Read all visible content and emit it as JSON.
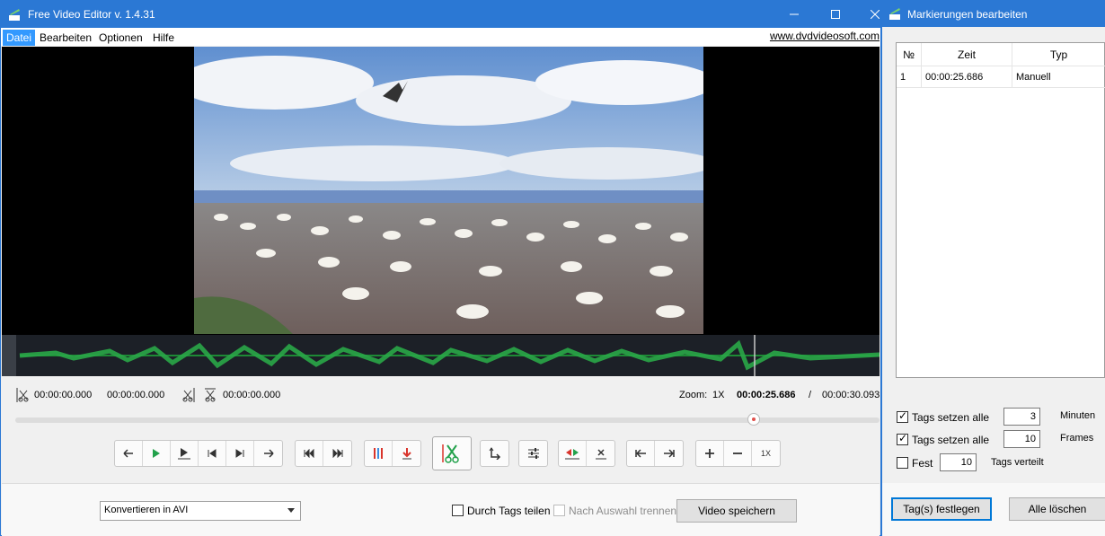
{
  "main_window": {
    "title": "Free Video Editor v. 1.4.31",
    "menu": [
      "Datei",
      "Bearbeiten",
      "Optionen",
      "Hilfe"
    ],
    "website": "www.dvdvideosoft.com"
  },
  "timeline": {
    "start_time": "00:00:00.000",
    "end_time": "00:00:00.000",
    "cut_time": "00:00:00.000",
    "zoom_label": "Zoom:",
    "zoom_value": "1X",
    "current_time": "00:00:25.686",
    "separator": "/",
    "total_time": "00:00:30.093",
    "position_fraction": 0.854
  },
  "toolbar": {
    "zoom_reset_label": "1X"
  },
  "bottom_bar": {
    "format_select": "Konvertieren in AVI",
    "split_by_tags_label": "Durch Tags teilen",
    "split_by_tags_checked": false,
    "split_by_selection_label": "Nach Auswahl trennen",
    "split_by_selection_enabled": false,
    "save_button": "Video speichern"
  },
  "tags_panel": {
    "title": "Markierungen bearbeiten",
    "columns": [
      "№",
      "Zeit",
      "Typ"
    ],
    "rows": [
      {
        "nr": "1",
        "time": "00:00:25.686",
        "type": "Manuell"
      }
    ],
    "option1": {
      "label": "Tags setzen alle",
      "value": "3",
      "unit": "Minuten",
      "checked": true
    },
    "option2": {
      "label": "Tags setzen alle",
      "value": "10",
      "unit": "Frames",
      "checked": true
    },
    "option3": {
      "label": "Fest",
      "value": "10",
      "unit": "Tags verteilt",
      "checked": false
    },
    "apply_button": "Tag(s) festlegen",
    "clear_button": "Alle löschen"
  },
  "colors": {
    "titlebar": "#2b78d4",
    "waveform": "#1d8a35",
    "accent_green": "#22a14b",
    "accent_red": "#d9342b"
  }
}
